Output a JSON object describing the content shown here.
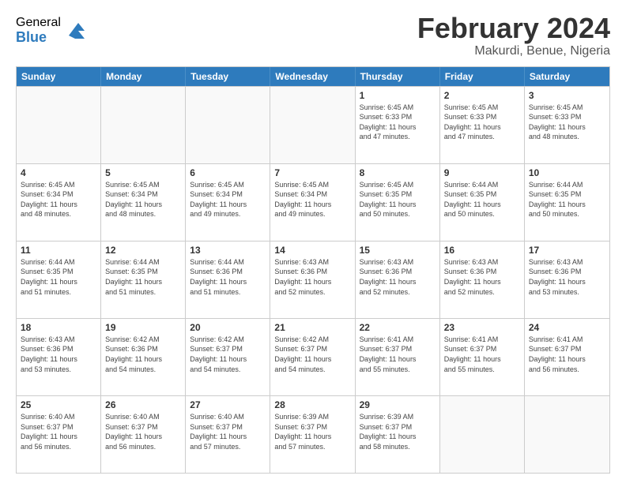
{
  "logo": {
    "general": "General",
    "blue": "Blue"
  },
  "title": "February 2024",
  "location": "Makurdi, Benue, Nigeria",
  "header_days": [
    "Sunday",
    "Monday",
    "Tuesday",
    "Wednesday",
    "Thursday",
    "Friday",
    "Saturday"
  ],
  "weeks": [
    [
      {
        "day": "",
        "info": ""
      },
      {
        "day": "",
        "info": ""
      },
      {
        "day": "",
        "info": ""
      },
      {
        "day": "",
        "info": ""
      },
      {
        "day": "1",
        "info": "Sunrise: 6:45 AM\nSunset: 6:33 PM\nDaylight: 11 hours\nand 47 minutes."
      },
      {
        "day": "2",
        "info": "Sunrise: 6:45 AM\nSunset: 6:33 PM\nDaylight: 11 hours\nand 47 minutes."
      },
      {
        "day": "3",
        "info": "Sunrise: 6:45 AM\nSunset: 6:33 PM\nDaylight: 11 hours\nand 48 minutes."
      }
    ],
    [
      {
        "day": "4",
        "info": "Sunrise: 6:45 AM\nSunset: 6:34 PM\nDaylight: 11 hours\nand 48 minutes."
      },
      {
        "day": "5",
        "info": "Sunrise: 6:45 AM\nSunset: 6:34 PM\nDaylight: 11 hours\nand 48 minutes."
      },
      {
        "day": "6",
        "info": "Sunrise: 6:45 AM\nSunset: 6:34 PM\nDaylight: 11 hours\nand 49 minutes."
      },
      {
        "day": "7",
        "info": "Sunrise: 6:45 AM\nSunset: 6:34 PM\nDaylight: 11 hours\nand 49 minutes."
      },
      {
        "day": "8",
        "info": "Sunrise: 6:45 AM\nSunset: 6:35 PM\nDaylight: 11 hours\nand 50 minutes."
      },
      {
        "day": "9",
        "info": "Sunrise: 6:44 AM\nSunset: 6:35 PM\nDaylight: 11 hours\nand 50 minutes."
      },
      {
        "day": "10",
        "info": "Sunrise: 6:44 AM\nSunset: 6:35 PM\nDaylight: 11 hours\nand 50 minutes."
      }
    ],
    [
      {
        "day": "11",
        "info": "Sunrise: 6:44 AM\nSunset: 6:35 PM\nDaylight: 11 hours\nand 51 minutes."
      },
      {
        "day": "12",
        "info": "Sunrise: 6:44 AM\nSunset: 6:35 PM\nDaylight: 11 hours\nand 51 minutes."
      },
      {
        "day": "13",
        "info": "Sunrise: 6:44 AM\nSunset: 6:36 PM\nDaylight: 11 hours\nand 51 minutes."
      },
      {
        "day": "14",
        "info": "Sunrise: 6:43 AM\nSunset: 6:36 PM\nDaylight: 11 hours\nand 52 minutes."
      },
      {
        "day": "15",
        "info": "Sunrise: 6:43 AM\nSunset: 6:36 PM\nDaylight: 11 hours\nand 52 minutes."
      },
      {
        "day": "16",
        "info": "Sunrise: 6:43 AM\nSunset: 6:36 PM\nDaylight: 11 hours\nand 52 minutes."
      },
      {
        "day": "17",
        "info": "Sunrise: 6:43 AM\nSunset: 6:36 PM\nDaylight: 11 hours\nand 53 minutes."
      }
    ],
    [
      {
        "day": "18",
        "info": "Sunrise: 6:43 AM\nSunset: 6:36 PM\nDaylight: 11 hours\nand 53 minutes."
      },
      {
        "day": "19",
        "info": "Sunrise: 6:42 AM\nSunset: 6:36 PM\nDaylight: 11 hours\nand 54 minutes."
      },
      {
        "day": "20",
        "info": "Sunrise: 6:42 AM\nSunset: 6:37 PM\nDaylight: 11 hours\nand 54 minutes."
      },
      {
        "day": "21",
        "info": "Sunrise: 6:42 AM\nSunset: 6:37 PM\nDaylight: 11 hours\nand 54 minutes."
      },
      {
        "day": "22",
        "info": "Sunrise: 6:41 AM\nSunset: 6:37 PM\nDaylight: 11 hours\nand 55 minutes."
      },
      {
        "day": "23",
        "info": "Sunrise: 6:41 AM\nSunset: 6:37 PM\nDaylight: 11 hours\nand 55 minutes."
      },
      {
        "day": "24",
        "info": "Sunrise: 6:41 AM\nSunset: 6:37 PM\nDaylight: 11 hours\nand 56 minutes."
      }
    ],
    [
      {
        "day": "25",
        "info": "Sunrise: 6:40 AM\nSunset: 6:37 PM\nDaylight: 11 hours\nand 56 minutes."
      },
      {
        "day": "26",
        "info": "Sunrise: 6:40 AM\nSunset: 6:37 PM\nDaylight: 11 hours\nand 56 minutes."
      },
      {
        "day": "27",
        "info": "Sunrise: 6:40 AM\nSunset: 6:37 PM\nDaylight: 11 hours\nand 57 minutes."
      },
      {
        "day": "28",
        "info": "Sunrise: 6:39 AM\nSunset: 6:37 PM\nDaylight: 11 hours\nand 57 minutes."
      },
      {
        "day": "29",
        "info": "Sunrise: 6:39 AM\nSunset: 6:37 PM\nDaylight: 11 hours\nand 58 minutes."
      },
      {
        "day": "",
        "info": ""
      },
      {
        "day": "",
        "info": ""
      }
    ]
  ]
}
